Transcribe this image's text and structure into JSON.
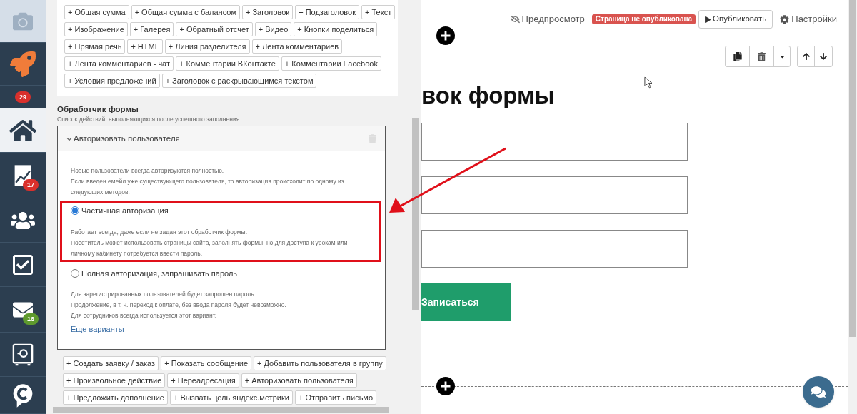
{
  "sidebar": {
    "items": [
      {
        "kind": "camera",
        "selected": false
      },
      {
        "kind": "rocket",
        "selected": false
      },
      {
        "kind": "counter",
        "selected": false,
        "badge": "29",
        "color": "#d9302c"
      },
      {
        "kind": "home",
        "selected": true
      },
      {
        "kind": "chart",
        "selected": false,
        "badge": "17",
        "color": "#d9302c"
      },
      {
        "kind": "users",
        "selected": false
      },
      {
        "kind": "tasks",
        "selected": false
      },
      {
        "kind": "mail",
        "selected": false,
        "badge": "16",
        "color": "#5e9a2e"
      },
      {
        "kind": "safe",
        "selected": false
      },
      {
        "kind": "chat",
        "selected": false
      }
    ]
  },
  "element_buttons": [
    [
      "+ Общая сумма",
      "+ Общая сумма с балансом",
      "+ Заголовок",
      "+ Подзаголовок",
      "+ Текст"
    ],
    [
      "+ Изображение",
      "+ Галерея",
      "+ Обратный отсчет",
      "+ Видео",
      "+ Кнопки поделиться"
    ],
    [
      "+ Прямая речь",
      "+ HTML",
      "+ Линия разделителя",
      "+ Лента комментариев"
    ],
    [
      "+ Лента комментариев - чат",
      "+ Комментарии ВКонтакте",
      "+ Комментарии Facebook"
    ],
    [
      "+ Условия предложений",
      "+ Заголовок с раскрывающимся текстом"
    ]
  ],
  "form_handler": {
    "title": "Обработчик формы",
    "subtitle": "Список действий, выполняющихся после успешного заполнения",
    "action": {
      "title": "Авторизовать пользователя",
      "expanded": true,
      "intro": [
        "Новые пользователи всегда авторизуются полностью.",
        "Если введен емейл уже существующего пользователя, то авторизация происходит по одному из следующих методов:"
      ],
      "options": [
        {
          "label": "Частичная авторизация",
          "selected": true,
          "description": [
            "Работает всегда, даже если не задан этот обработчик формы.",
            "Посетитель может использовать страницы сайта, заполнять формы, но для доступа к урокам или личному кабинету потребуется ввести пароль."
          ]
        },
        {
          "label": "Полная авторизация, запрашивать пароль",
          "selected": false,
          "description": [
            "Для зарегистрированных пользователей будет запрошен пароль.",
            "Продолжение, в т. ч. переход к оплате, без ввода пароля будет невозможно.",
            "Для сотрудников всегда используется этот вариант."
          ]
        }
      ],
      "more_link": "Еще варианты"
    },
    "action_buttons": [
      [
        "+ Создать заявку / заказ",
        "+ Показать сообщение",
        "+ Добавить пользователя в группу"
      ],
      [
        "+ Произвольное действие",
        "+ Переадресация",
        "+ Авторизовать пользователя"
      ],
      [
        "+ Предложить дополнение",
        "+ Вызвать цель яндекс.метрики",
        "+ Отправить письмо"
      ]
    ]
  },
  "topbar": {
    "preview": "Предпросмотр",
    "status": "Страница не опубликована",
    "publish": "Опубликовать",
    "settings": "Настройки"
  },
  "form": {
    "heading": "вок формы",
    "fields": [
      {
        "kind": "text"
      },
      {
        "kind": "text"
      },
      {
        "kind": "text"
      }
    ],
    "submit": "Записаться"
  }
}
